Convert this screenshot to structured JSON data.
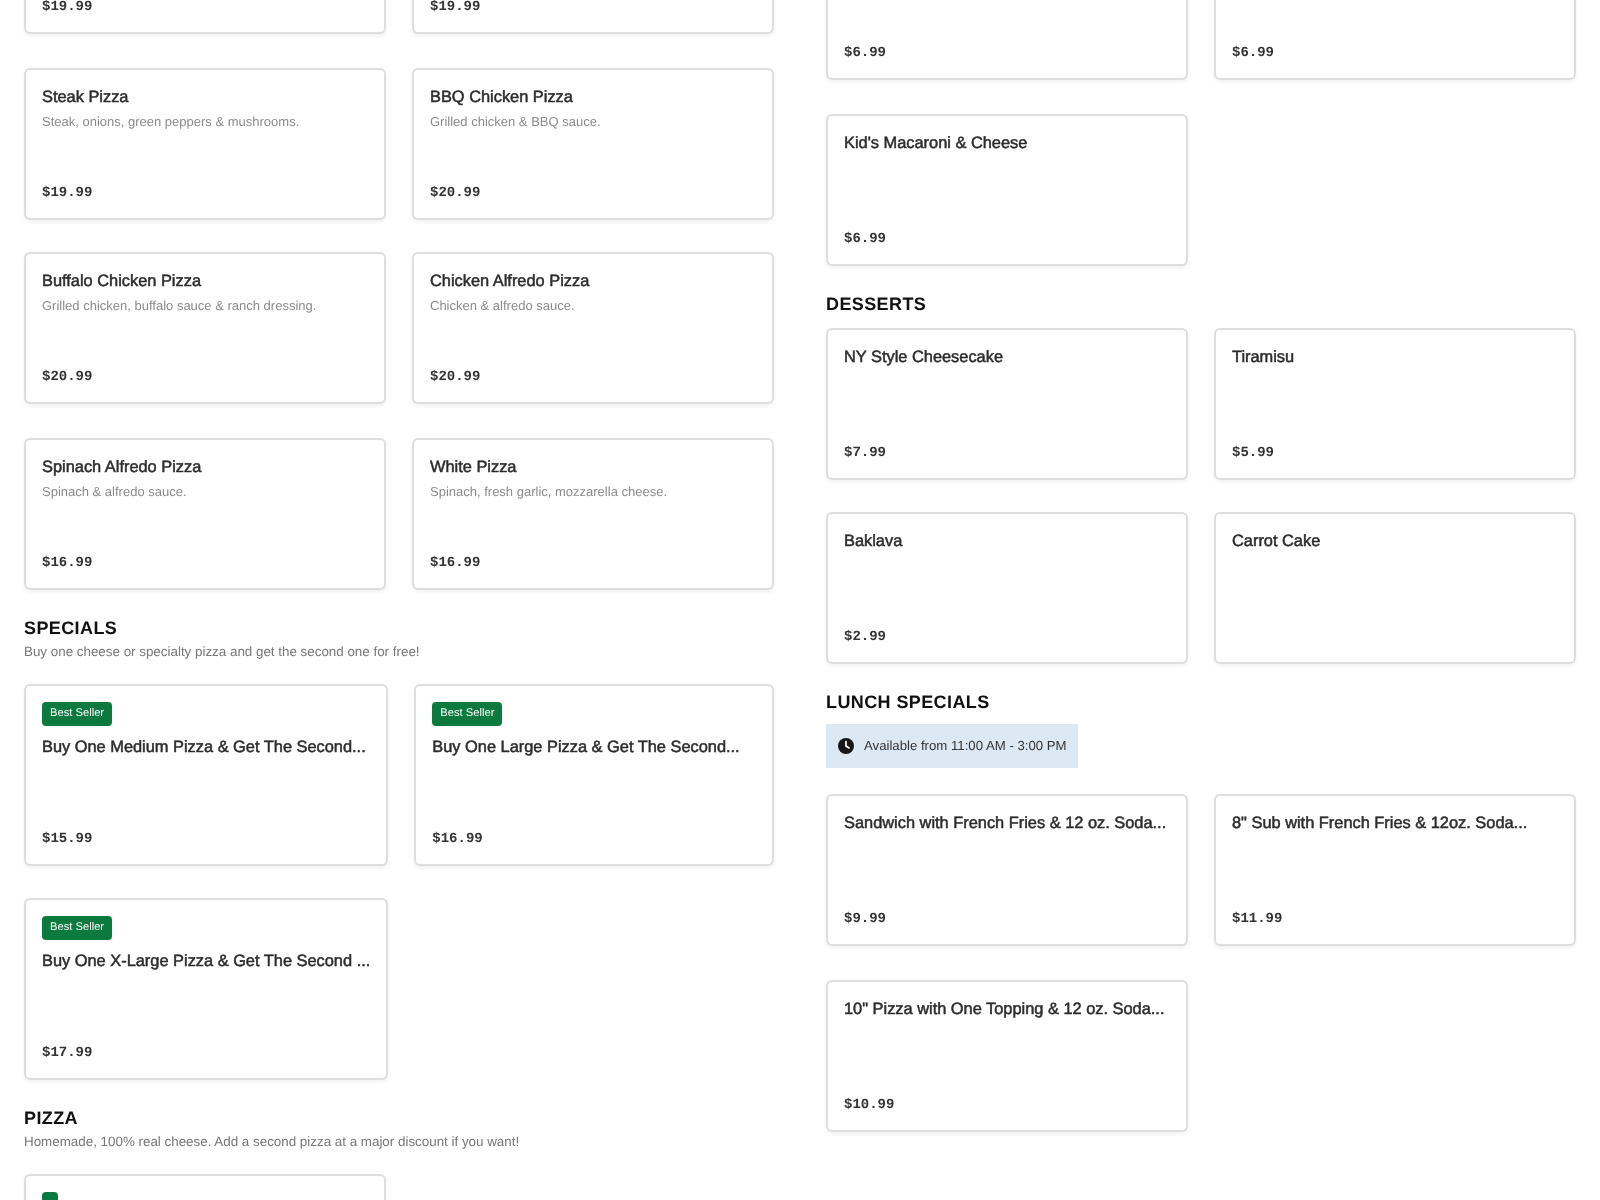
{
  "columns": [
    {
      "sections": [
        {
          "items": [
            {
              "price": "$19.99"
            },
            {
              "price": "$19.99"
            },
            {
              "name": "Steak Pizza",
              "description": "Steak, onions, green peppers & mushrooms.",
              "price": "$19.99"
            },
            {
              "name": "BBQ Chicken Pizza",
              "description": "Grilled chicken & BBQ sauce.",
              "price": "$20.99"
            },
            {
              "name": "Buffalo Chicken Pizza",
              "description": "Grilled chicken, buffalo sauce & ranch dressing.",
              "price": "$20.99"
            },
            {
              "name": "Chicken Alfredo Pizza",
              "description": "Chicken & alfredo sauce.",
              "price": "$20.99"
            },
            {
              "name": "Spinach Alfredo Pizza",
              "description": "Spinach & alfredo sauce.",
              "price": "$16.99"
            },
            {
              "name": "White Pizza",
              "description": "Spinach, fresh garlic, mozzarella cheese.",
              "price": "$16.99"
            }
          ]
        },
        {
          "title": "SPECIALS",
          "description": "Buy one cheese or specialty pizza and get the second one for free!",
          "items": [
            {
              "badge": "Best Seller",
              "name": "Buy One Medium Pizza & Get The Second...",
              "price": "$15.99"
            },
            {
              "badge": "Best Seller",
              "name": "Buy One Large Pizza & Get The Second...",
              "price": "$16.99"
            },
            {
              "badge": "Best Seller",
              "name": "Buy One X-Large Pizza & Get The Second ...",
              "price": "$17.99"
            }
          ]
        },
        {
          "title": "PIZZA",
          "description": "Homemade, 100% real cheese. Add a second pizza at a major discount if you want!",
          "items": [
            {
              "tagged": true
            }
          ]
        }
      ]
    },
    {
      "sections": [
        {
          "items": [
            {
              "price": "$6.99"
            },
            {
              "price": "$6.99"
            },
            {
              "name": "Kid's Macaroni & Cheese",
              "price": "$6.99"
            }
          ]
        },
        {
          "title": "DESSERTS",
          "items": [
            {
              "name": "NY Style Cheesecake",
              "price": "$7.99"
            },
            {
              "name": "Tiramisu",
              "price": "$5.99"
            },
            {
              "name": "Baklava",
              "price": "$2.99"
            },
            {
              "name": "Carrot Cake"
            }
          ]
        },
        {
          "title": "LUNCH SPECIALS",
          "availability": "Available from 11:00 AM - 3:00 PM",
          "items": [
            {
              "name": "Sandwich with French Fries & 12 oz. Soda...",
              "price": "$9.99"
            },
            {
              "name": "8\" Sub with French Fries & 12oz. Soda...",
              "price": "$11.99"
            },
            {
              "name": "10\" Pizza with One Topping & 12 oz. Soda...",
              "price": "$10.99"
            }
          ]
        }
      ]
    }
  ]
}
